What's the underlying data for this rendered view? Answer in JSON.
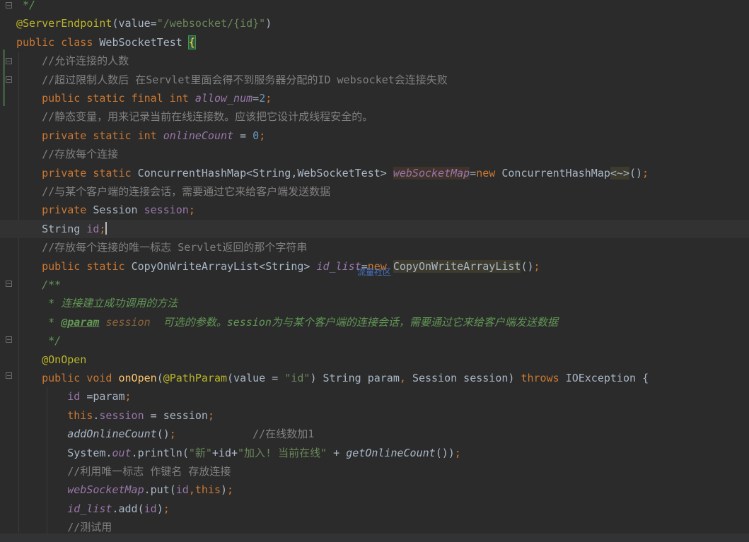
{
  "lines": [
    {
      "segs": [
        {
          "t": " */",
          "c": "doc"
        }
      ]
    },
    {
      "segs": [
        {
          "t": "@ServerEndpoint",
          "c": "ann"
        },
        {
          "t": "(",
          "c": "paren"
        },
        {
          "t": "value",
          "c": ""
        },
        {
          "t": "=",
          "c": ""
        },
        {
          "t": "\"/websocket/{id}\"",
          "c": "str"
        },
        {
          "t": ")",
          "c": "paren"
        }
      ]
    },
    {
      "segs": [
        {
          "t": "public ",
          "c": "kw"
        },
        {
          "t": "class ",
          "c": "kw"
        },
        {
          "t": "WebSocketTest ",
          "c": ""
        },
        {
          "t": "{",
          "c": "hl-brace"
        }
      ]
    },
    {
      "segs": [
        {
          "t": "    //允许连接的人数",
          "c": "cmt"
        }
      ]
    },
    {
      "segs": [
        {
          "t": "    //超过限制人数后 在Servlet里面会得不到服务器分配的ID websocket会连接失败",
          "c": "cmt"
        }
      ]
    },
    {
      "segs": [
        {
          "t": "    public ",
          "c": "kw"
        },
        {
          "t": "static ",
          "c": "kw"
        },
        {
          "t": "final ",
          "c": "kw"
        },
        {
          "t": "int ",
          "c": "kw"
        },
        {
          "t": "allow_num",
          "c": "sfield"
        },
        {
          "t": "=",
          "c": ""
        },
        {
          "t": "2",
          "c": "num"
        },
        {
          "t": ";",
          "c": "kw"
        }
      ]
    },
    {
      "segs": [
        {
          "t": "    //静态变量，用来记录当前在线连接数。应该把它设计成线程安全的。",
          "c": "cmt"
        }
      ]
    },
    {
      "segs": [
        {
          "t": "    private ",
          "c": "kw"
        },
        {
          "t": "static ",
          "c": "kw"
        },
        {
          "t": "int ",
          "c": "kw"
        },
        {
          "t": "onlineCount",
          "c": "sfield"
        },
        {
          "t": " = ",
          "c": ""
        },
        {
          "t": "0",
          "c": "num"
        },
        {
          "t": ";",
          "c": "kw"
        }
      ]
    },
    {
      "segs": [
        {
          "t": "    //存放每个连接",
          "c": "cmt"
        }
      ]
    },
    {
      "segs": [
        {
          "t": "    private ",
          "c": "kw"
        },
        {
          "t": "static ",
          "c": "kw"
        },
        {
          "t": "ConcurrentHashMap<String,WebSocketTest> ",
          "c": ""
        },
        {
          "t": "webSocketMap",
          "c": "sfield hl-usage"
        },
        {
          "t": "=",
          "c": ""
        },
        {
          "t": "new ",
          "c": "kw"
        },
        {
          "t": "ConcurrentHashMap",
          "c": ""
        },
        {
          "t": "<~>",
          "c": "hl-usage2"
        },
        {
          "t": "()",
          "c": "paren"
        },
        {
          "t": ";",
          "c": "kw"
        }
      ]
    },
    {
      "segs": [
        {
          "t": "    //与某个客户端的连接会话，需要通过它来给客户端发送数据",
          "c": "cmt"
        }
      ]
    },
    {
      "segs": [
        {
          "t": "    private ",
          "c": "kw"
        },
        {
          "t": "Session ",
          "c": ""
        },
        {
          "t": "session",
          "c": "field"
        },
        {
          "t": ";",
          "c": "kw"
        }
      ]
    },
    {
      "segs": [
        {
          "t": "    String ",
          "c": ""
        },
        {
          "t": "id",
          "c": "field"
        },
        {
          "t": ";",
          "c": "kw"
        },
        {
          "t": "|",
          "c": "caret"
        }
      ],
      "current": true
    },
    {
      "segs": [
        {
          "t": "    //存放每个连接的唯一标志 Servlet返回的那个字符串",
          "c": "cmt"
        }
      ]
    },
    {
      "segs": [
        {
          "t": "    public ",
          "c": "kw"
        },
        {
          "t": "static ",
          "c": "kw"
        },
        {
          "t": "CopyOnWriteArrayList<String> ",
          "c": ""
        },
        {
          "t": "id_list",
          "c": "sfield"
        },
        {
          "t": "=",
          "c": ""
        },
        {
          "t": "new ",
          "c": "kw"
        },
        {
          "t": "CopyOnWriteArrayList",
          "c": "hl-usage2"
        },
        {
          "t": "()",
          "c": "paren"
        },
        {
          "t": ";",
          "c": "kw"
        }
      ]
    },
    {
      "segs": [
        {
          "t": "    /**",
          "c": "doc"
        }
      ]
    },
    {
      "segs": [
        {
          "t": "     * 连接建立成功调用的方法",
          "c": "doc"
        }
      ]
    },
    {
      "segs": [
        {
          "t": "     * ",
          "c": "doc"
        },
        {
          "t": "@param",
          "c": "doctag"
        },
        {
          "t": " ",
          "c": "doc"
        },
        {
          "t": "session",
          "c": "docparam"
        },
        {
          "t": "  可选的参数。session为与某个客户端的连接会话，需要通过它来给客户端发送数据",
          "c": "doc"
        }
      ]
    },
    {
      "segs": [
        {
          "t": "     */",
          "c": "doc"
        }
      ]
    },
    {
      "segs": [
        {
          "t": "    @OnOpen",
          "c": "ann"
        }
      ]
    },
    {
      "segs": [
        {
          "t": "    public ",
          "c": "kw"
        },
        {
          "t": "void ",
          "c": "kw"
        },
        {
          "t": "onOpen",
          "c": "method"
        },
        {
          "t": "(",
          "c": "paren"
        },
        {
          "t": "@PathParam",
          "c": "ann"
        },
        {
          "t": "(",
          "c": "paren"
        },
        {
          "t": "value = ",
          "c": ""
        },
        {
          "t": "\"id\"",
          "c": "str"
        },
        {
          "t": ") ",
          "c": "paren"
        },
        {
          "t": "String param",
          "c": ""
        },
        {
          "t": ", ",
          "c": "kw"
        },
        {
          "t": "Session session) ",
          "c": ""
        },
        {
          "t": "throws ",
          "c": "kw"
        },
        {
          "t": "IOException ",
          "c": ""
        },
        {
          "t": "{",
          "c": "paren"
        }
      ]
    },
    {
      "segs": [
        {
          "t": "        id",
          "c": "field"
        },
        {
          "t": " =param",
          "c": ""
        },
        {
          "t": ";",
          "c": "kw"
        }
      ]
    },
    {
      "segs": [
        {
          "t": "        this",
          "c": "kw"
        },
        {
          "t": ".",
          "c": ""
        },
        {
          "t": "session",
          "c": "field"
        },
        {
          "t": " = session",
          "c": ""
        },
        {
          "t": ";",
          "c": "kw"
        }
      ]
    },
    {
      "segs": [
        {
          "t": "        addOnlineCount",
          "c": "smethod"
        },
        {
          "t": "()",
          "c": "paren"
        },
        {
          "t": ";",
          "c": "kw"
        },
        {
          "t": "            //在线数加1",
          "c": "cmt"
        }
      ]
    },
    {
      "segs": [
        {
          "t": "        System.",
          "c": ""
        },
        {
          "t": "out",
          "c": "sfield"
        },
        {
          "t": ".println",
          "c": ""
        },
        {
          "t": "(",
          "c": "paren"
        },
        {
          "t": "\"新\"",
          "c": "str"
        },
        {
          "t": "+id+",
          "c": ""
        },
        {
          "t": "\"加入! 当前在线\"",
          "c": "str"
        },
        {
          "t": " + ",
          "c": ""
        },
        {
          "t": "getOnlineCount",
          "c": "smethod"
        },
        {
          "t": "())",
          "c": "paren"
        },
        {
          "t": ";",
          "c": "kw"
        }
      ]
    },
    {
      "segs": [
        {
          "t": "        //利用唯一标志 作键名 存放连接",
          "c": "cmt"
        }
      ]
    },
    {
      "segs": [
        {
          "t": "        webSocketMap",
          "c": "sfield"
        },
        {
          "t": ".put",
          "c": ""
        },
        {
          "t": "(",
          "c": "paren"
        },
        {
          "t": "id",
          "c": "field"
        },
        {
          "t": ",",
          "c": "kw"
        },
        {
          "t": "this",
          "c": "kw"
        },
        {
          "t": ")",
          "c": "paren"
        },
        {
          "t": ";",
          "c": "kw"
        }
      ]
    },
    {
      "segs": [
        {
          "t": "        id_list",
          "c": "sfield"
        },
        {
          "t": ".add",
          "c": ""
        },
        {
          "t": "(",
          "c": "paren"
        },
        {
          "t": "id",
          "c": "field"
        },
        {
          "t": ")",
          "c": "paren"
        },
        {
          "t": ";",
          "c": "kw"
        }
      ]
    },
    {
      "segs": [
        {
          "t": "        //测试用",
          "c": "cmt"
        }
      ]
    }
  ],
  "watermark": "流量社区"
}
